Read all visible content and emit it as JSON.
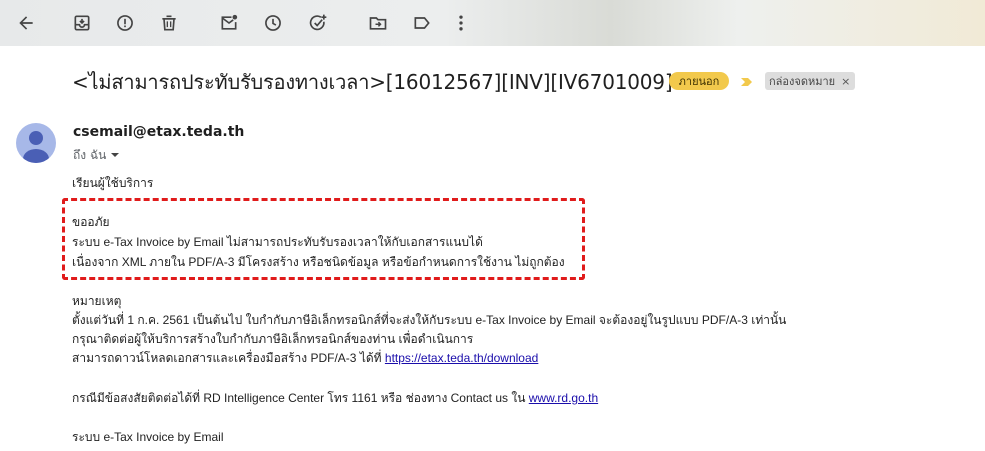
{
  "toolbar": {
    "icons": [
      "back-arrow-icon",
      "archive-icon",
      "report-spam-icon",
      "delete-icon",
      "mark-unread-icon",
      "snooze-icon",
      "add-task-icon",
      "move-to-icon",
      "label-icon",
      "more-vert-icon"
    ]
  },
  "email": {
    "subject": "<ไม่สามารถประทับรับรองทางเวลา>[16012567][INV][IV6701009]",
    "labels": {
      "external": "ภายนอก",
      "inbox": "กล่องจดหมาย",
      "inbox_remove": "×"
    },
    "sender": "csemail@etax.teda.th",
    "to": "ถึง ฉัน",
    "greeting": "เรียนผู้ใช้บริการ",
    "error_block": {
      "line1": "ขออภัย",
      "line2": "ระบบ e-Tax Invoice by Email ไม่สามารถประทับรับรองเวลาให้กับเอกสารแนบได้",
      "line3": "เนื่องจาก XML ภายใน PDF/A-3 มีโครงสร้าง หรือชนิดข้อมูล หรือข้อกำหนดการใช้งาน ไม่ถูกต้อง"
    },
    "note": {
      "title": "หมายเหตุ",
      "line1": "ตั้งแต่วันที่ 1 ก.ค. 2561 เป็นต้นไป ใบกำกับภาษีอิเล็กทรอนิกส์ที่จะส่งให้กับระบบ e-Tax Invoice by Email จะต้องอยู่ในรูปแบบ PDF/A-3 เท่านั้น",
      "line2": "กรุณาติดต่อผู้ให้บริการสร้างใบกำกับภาษีอิเล็กทรอนิกส์ของท่าน เพื่อดำเนินการ",
      "line3_prefix": "สามารถดาวน์โหลดเอกสารและเครื่องมือสร้าง PDF/A-3 ได้ที่ ",
      "line3_link": "https://etax.teda.th/download"
    },
    "contact": {
      "prefix": "กรณีมีข้อสงสัยติดต่อได้ที่ RD Intelligence Center โทร 1161 หรือ ช่องทาง Contact us ใน ",
      "link": "www.rd.go.th"
    },
    "signature": "ระบบ e-Tax Invoice by Email"
  },
  "colors": {
    "highlight_box": "#e01b1b",
    "external_chip": "#f2c94c",
    "link": "#1a0dab"
  }
}
